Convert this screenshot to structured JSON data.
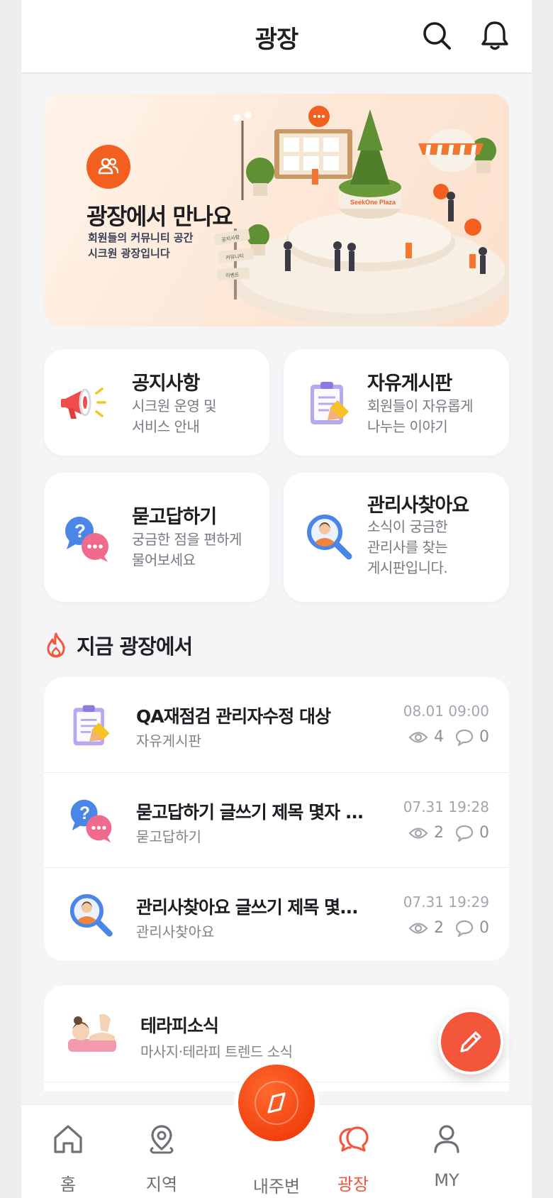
{
  "header": {
    "title": "광장",
    "search_icon": "search-icon",
    "bell_icon": "bell-icon"
  },
  "banner": {
    "title": "광장에서 만나요",
    "subtitle_line1": "회원들의 커뮤니티 공간",
    "subtitle_line2": "시크원 광장입니다",
    "sign_labels": [
      "공지사항",
      "커뮤니티",
      "이벤트"
    ],
    "fountain_label": "SeekOne Plaza"
  },
  "categories": [
    {
      "title": "공지사항",
      "desc1": "시크원 운영 및",
      "desc2": "서비스 안내",
      "desc3": "",
      "icon": "megaphone-icon"
    },
    {
      "title": "자유게시판",
      "desc1": "회원들이 자유롭게",
      "desc2": "나누는 이야기",
      "desc3": "",
      "icon": "clipboard-icon"
    },
    {
      "title": "묻고답하기",
      "desc1": "궁금한 점을 편하게",
      "desc2": "물어보세요",
      "desc3": "",
      "icon": "qa-bubble-icon"
    },
    {
      "title": "관리사찾아요",
      "desc1": "소식이 궁금한",
      "desc2": "관리사를 찾는",
      "desc3": "게시판입니다.",
      "icon": "search-person-icon"
    }
  ],
  "hot_section": {
    "title": "지금 광장에서",
    "icon": "fire-icon"
  },
  "posts": [
    {
      "title": "QA재점검 관리자수정 대상",
      "board": "자유게시판",
      "date": "08.01 09:00",
      "views": "4",
      "comments": "0"
    },
    {
      "title": "묻고답하기 글쓰기 제목 몇자 ...",
      "board": "묻고답하기",
      "date": "07.31 19:28",
      "views": "2",
      "comments": "0"
    },
    {
      "title": "관리사찾아요 글쓰기 제목 몇...",
      "board": "관리사찾아요",
      "date": "07.31 19:29",
      "views": "2",
      "comments": "0"
    }
  ],
  "therapy": {
    "title": "테라피소식",
    "desc": "마사지·테라피 트렌드 소식"
  },
  "nav": {
    "items": [
      {
        "label": "홈",
        "icon": "home-icon"
      },
      {
        "label": "지역",
        "icon": "location-pin-icon"
      },
      {
        "label": "내주변",
        "icon": "compass-icon"
      },
      {
        "label": "광장",
        "icon": "chat-bubbles-icon"
      },
      {
        "label": "MY",
        "icon": "person-icon"
      }
    ],
    "active": "광장"
  },
  "colors": {
    "accent": "#f4563c",
    "brand_orange": "#f25f1f",
    "background": "#f5f5f8"
  }
}
